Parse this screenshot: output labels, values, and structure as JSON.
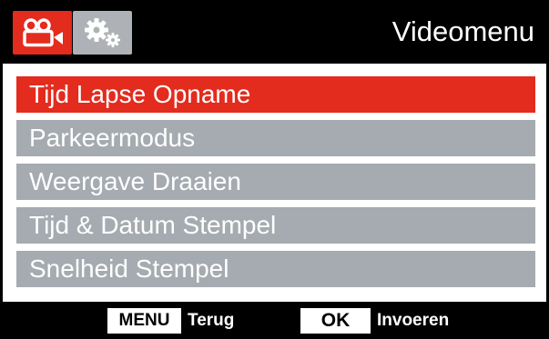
{
  "header": {
    "title": "Videomenu",
    "tabs": [
      {
        "icon": "video-camera-icon",
        "active": true
      },
      {
        "icon": "settings-gears-icon",
        "active": false
      }
    ]
  },
  "menu": {
    "items": [
      {
        "label": "Tijd Lapse Opname",
        "selected": true
      },
      {
        "label": "Parkeermodus",
        "selected": false
      },
      {
        "label": "Weergave Draaien",
        "selected": false
      },
      {
        "label": "Tijd & Datum Stempel",
        "selected": false
      },
      {
        "label": "Snelheid Stempel",
        "selected": false
      }
    ]
  },
  "footer": {
    "menu_key": "MENU",
    "menu_action": "Terug",
    "ok_key": "OK",
    "ok_action": "Invoeren"
  },
  "colors": {
    "accent": "#e32b1e",
    "item_bg": "#a5abb0",
    "inactive_tab": "#aeb2b6"
  }
}
